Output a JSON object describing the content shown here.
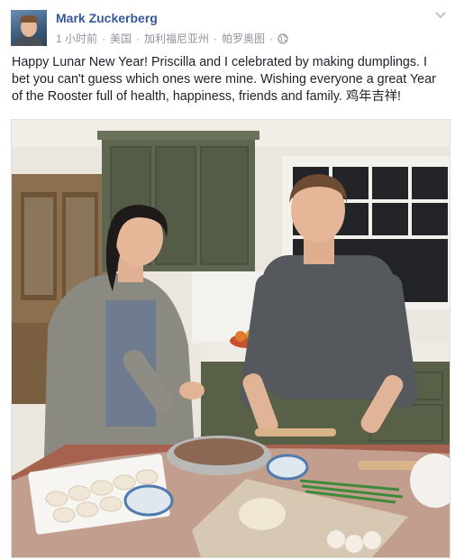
{
  "post": {
    "author": "Mark Zuckerberg",
    "timestamp": "1 小时前",
    "location_country": "美国",
    "location_region": "加利福尼亚州",
    "location_city": "帕罗奥图",
    "privacy_icon": "globe-icon",
    "options_icon": "chevron-down-icon",
    "caption": "Happy Lunar New Year! Priscilla and I celebrated by making dumplings. I bet you can't guess which ones were mine. Wishing everyone a great Year of the Rooster full of health, happiness, friends and family. 鸡年吉祥!"
  },
  "colors": {
    "author_link": "#365899",
    "meta_text": "#90949c",
    "body_text": "#1d2129"
  }
}
